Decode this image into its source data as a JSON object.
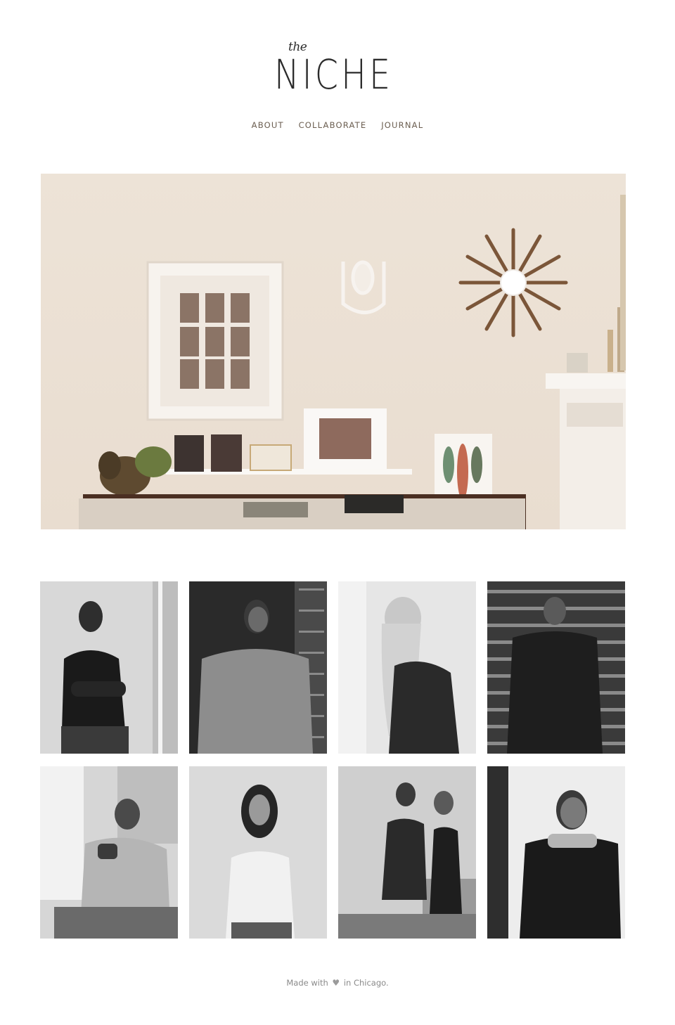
{
  "logo": {
    "small": "the",
    "main": "NICHE"
  },
  "nav": {
    "items": [
      {
        "label": "ABOUT"
      },
      {
        "label": "COLLABORATE"
      },
      {
        "label": "JOURNAL"
      }
    ]
  },
  "footer": {
    "made_with": "Made with",
    "heart": "♥",
    "location": "in Chicago."
  },
  "colors": {
    "nav_text": "#6b5e50",
    "footer_text": "#8a8a8a",
    "logo_text": "#2b2b2b"
  }
}
